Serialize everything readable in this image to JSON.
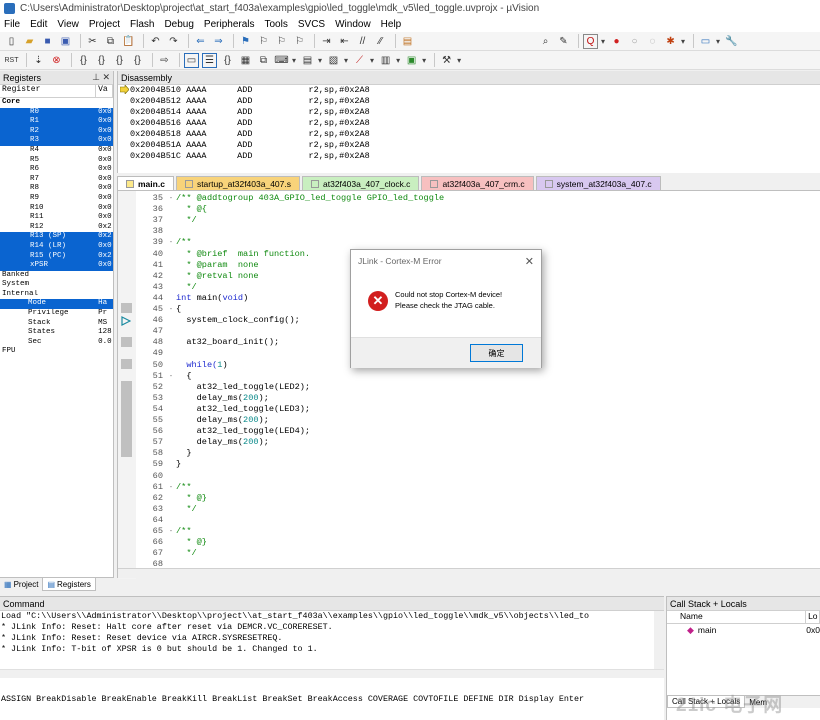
{
  "window": {
    "title": "C:\\Users\\Administrator\\Desktop\\project\\at_start_f403a\\examples\\gpio\\led_toggle\\mdk_v5\\led_toggle.uvprojx - µVision"
  },
  "menu": [
    "File",
    "Edit",
    "View",
    "Project",
    "Flash",
    "Debug",
    "Peripherals",
    "Tools",
    "SVCS",
    "Window",
    "Help"
  ],
  "registers": {
    "title": "Registers",
    "columns": [
      "Register",
      "Va"
    ],
    "rows": [
      {
        "name": "Core",
        "value": "",
        "selected": false,
        "group": true
      },
      {
        "name": "R0",
        "value": "0x0",
        "selected": true
      },
      {
        "name": "R1",
        "value": "0x0",
        "selected": true
      },
      {
        "name": "R2",
        "value": "0x0",
        "selected": true
      },
      {
        "name": "R3",
        "value": "0x0",
        "selected": true
      },
      {
        "name": "R4",
        "value": "0x0",
        "selected": false
      },
      {
        "name": "R5",
        "value": "0x0",
        "selected": false
      },
      {
        "name": "R6",
        "value": "0x0",
        "selected": false
      },
      {
        "name": "R7",
        "value": "0x0",
        "selected": false
      },
      {
        "name": "R8",
        "value": "0x0",
        "selected": false
      },
      {
        "name": "R9",
        "value": "0x0",
        "selected": false
      },
      {
        "name": "R10",
        "value": "0x0",
        "selected": false
      },
      {
        "name": "R11",
        "value": "0x0",
        "selected": false
      },
      {
        "name": "R12",
        "value": "0x2",
        "selected": false
      },
      {
        "name": "R13 (SP)",
        "value": "0x2",
        "selected": true
      },
      {
        "name": "R14 (LR)",
        "value": "0x0",
        "selected": true
      },
      {
        "name": "R15 (PC)",
        "value": "0x2",
        "selected": true
      },
      {
        "name": "xPSR",
        "value": "0x0",
        "selected": true
      },
      {
        "name": "Banked",
        "value": "",
        "selected": false,
        "group": true
      },
      {
        "name": "System",
        "value": "",
        "selected": false,
        "group": true
      },
      {
        "name": "Internal",
        "value": "",
        "selected": false,
        "group": true
      },
      {
        "name": "Mode",
        "value": "Ha",
        "selected": true
      },
      {
        "name": "Privilege",
        "value": "Pr",
        "selected": false
      },
      {
        "name": "Stack",
        "value": "MS",
        "selected": false
      },
      {
        "name": "States",
        "value": "128",
        "selected": false
      },
      {
        "name": "Sec",
        "value": "0.0",
        "selected": false
      },
      {
        "name": "FPU",
        "value": "",
        "selected": false,
        "group": true
      }
    ],
    "tabs": [
      "Project",
      "Registers"
    ]
  },
  "disassembly": {
    "title": "Disassembly",
    "lines": [
      "0x2004B510 AAAA      ADD           r2,sp,#0x2A8",
      "0x2004B512 AAAA      ADD           r2,sp,#0x2A8",
      "0x2004B514 AAAA      ADD           r2,sp,#0x2A8",
      "0x2004B516 AAAA      ADD           r2,sp,#0x2A8",
      "0x2004B518 AAAA      ADD           r2,sp,#0x2A8",
      "0x2004B51A AAAA      ADD           r2,sp,#0x2A8",
      "0x2004B51C AAAA      ADD           r2,sp,#0x2A8"
    ]
  },
  "editor_tabs": [
    {
      "label": "main.c",
      "active": true,
      "color": "#fde98a"
    },
    {
      "label": "startup_at32f403a_407.s",
      "active": false,
      "color": "#f8d37a"
    },
    {
      "label": "at32f403a_407_clock.c",
      "active": false,
      "color": "#c9efc0"
    },
    {
      "label": "at32f403a_407_crm.c",
      "active": false,
      "color": "#f7c0c0"
    },
    {
      "label": "system_at32f403a_407.c",
      "active": false,
      "color": "#d8c8f0"
    }
  ],
  "code": [
    {
      "num": "35",
      "fold": "-",
      "text": "/** @addtogroup 403A_GPIO_led_toggle GPIO_led_toggle",
      "cls": "c-green"
    },
    {
      "num": "36",
      "fold": "",
      "text": "  * @{",
      "cls": "c-green"
    },
    {
      "num": "37",
      "fold": "",
      "text": "  */",
      "cls": "c-green"
    },
    {
      "num": "38",
      "fold": "",
      "text": "",
      "cls": ""
    },
    {
      "num": "39",
      "fold": "-",
      "text": "/**",
      "cls": "c-green"
    },
    {
      "num": "40",
      "fold": "",
      "text": "  * @brief  main function.",
      "cls": "c-green"
    },
    {
      "num": "41",
      "fold": "",
      "text": "  * @param  none",
      "cls": "c-green"
    },
    {
      "num": "42",
      "fold": "",
      "text": "  * @retval none",
      "cls": "c-green"
    },
    {
      "num": "43",
      "fold": "",
      "text": "  */",
      "cls": "c-green"
    },
    {
      "num": "44",
      "fold": "",
      "text": "int main(void)",
      "cls": "c-blue"
    },
    {
      "num": "45",
      "fold": "-",
      "text": "{",
      "cls": ""
    },
    {
      "num": "46",
      "fold": "",
      "text": "  system_clock_config();",
      "cls": ""
    },
    {
      "num": "47",
      "fold": "",
      "text": "",
      "cls": ""
    },
    {
      "num": "48",
      "fold": "",
      "text": "  at32_board_init();",
      "cls": ""
    },
    {
      "num": "49",
      "fold": "",
      "text": "",
      "cls": ""
    },
    {
      "num": "50",
      "fold": "",
      "text": "  while(1)",
      "cls": "c-blue"
    },
    {
      "num": "51",
      "fold": "-",
      "text": "  {",
      "cls": ""
    },
    {
      "num": "52",
      "fold": "",
      "text": "    at32_led_toggle(LED2);",
      "cls": ""
    },
    {
      "num": "53",
      "fold": "",
      "text": "    delay_ms(200);",
      "cls": ""
    },
    {
      "num": "54",
      "fold": "",
      "text": "    at32_led_toggle(LED3);",
      "cls": ""
    },
    {
      "num": "55",
      "fold": "",
      "text": "    delay_ms(200);",
      "cls": ""
    },
    {
      "num": "56",
      "fold": "",
      "text": "    at32_led_toggle(LED4);",
      "cls": ""
    },
    {
      "num": "57",
      "fold": "",
      "text": "    delay_ms(200);",
      "cls": ""
    },
    {
      "num": "58",
      "fold": "",
      "text": "  }",
      "cls": ""
    },
    {
      "num": "59",
      "fold": "",
      "text": "}",
      "cls": ""
    },
    {
      "num": "60",
      "fold": "",
      "text": "",
      "cls": ""
    },
    {
      "num": "61",
      "fold": "-",
      "text": "/**",
      "cls": "c-green"
    },
    {
      "num": "62",
      "fold": "",
      "text": "  * @}",
      "cls": "c-green"
    },
    {
      "num": "63",
      "fold": "",
      "text": "  */",
      "cls": "c-green"
    },
    {
      "num": "64",
      "fold": "",
      "text": "",
      "cls": ""
    },
    {
      "num": "65",
      "fold": "-",
      "text": "/**",
      "cls": "c-green"
    },
    {
      "num": "66",
      "fold": "",
      "text": "  * @}",
      "cls": "c-green"
    },
    {
      "num": "67",
      "fold": "",
      "text": "  */",
      "cls": "c-green"
    },
    {
      "num": "68",
      "fold": "",
      "text": "",
      "cls": ""
    }
  ],
  "dialog": {
    "title": "JLink - Cortex-M Error",
    "message_line1": "Could not stop Cortex-M device!",
    "message_line2": "Please check the JTAG cable.",
    "ok_label": "确定"
  },
  "command": {
    "title": "Command",
    "lines": [
      "Load \"C:\\\\Users\\\\Administrator\\\\Desktop\\\\project\\\\at_start_f403a\\\\examples\\\\gpio\\\\led_toggle\\\\mdk_v5\\\\objects\\\\led_to",
      "* JLink Info: Reset: Halt core after reset via DEMCR.VC_CORERESET.",
      "* JLink Info: Reset: Reset device via AIRCR.SYSRESETREQ.",
      "* JLink Info: T-bit of XPSR is 0 but should be 1. Changed to 1."
    ],
    "help": "ASSIGN BreakDisable BreakEnable BreakKill BreakList BreakSet BreakAccess COVERAGE COVTOFILE DEFINE DIR Display Enter"
  },
  "callstack": {
    "title": "Call Stack + Locals",
    "col_name": "Name",
    "col_loc": "Lo",
    "row_name": "main",
    "row_loc": "0x0",
    "tabs": [
      "Call Stack + Locals",
      "Mem"
    ]
  },
  "watermark": "21ic 电子网"
}
